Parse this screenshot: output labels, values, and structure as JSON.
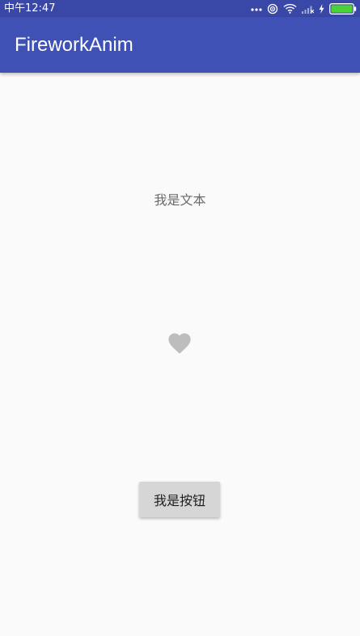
{
  "status_bar": {
    "time": "中午12:47",
    "icons": [
      "more-dots-icon",
      "hotspot-icon",
      "wifi-icon",
      "signal-icon",
      "charging-bolt-icon",
      "battery-icon"
    ],
    "battery_color": "#4cd137"
  },
  "app_bar": {
    "title": "FireworkAnim",
    "color": "#3f51b5"
  },
  "main": {
    "text": "我是文本",
    "icon": "heart-icon",
    "icon_color": "#bdbdbd",
    "button_label": "我是按钮"
  }
}
